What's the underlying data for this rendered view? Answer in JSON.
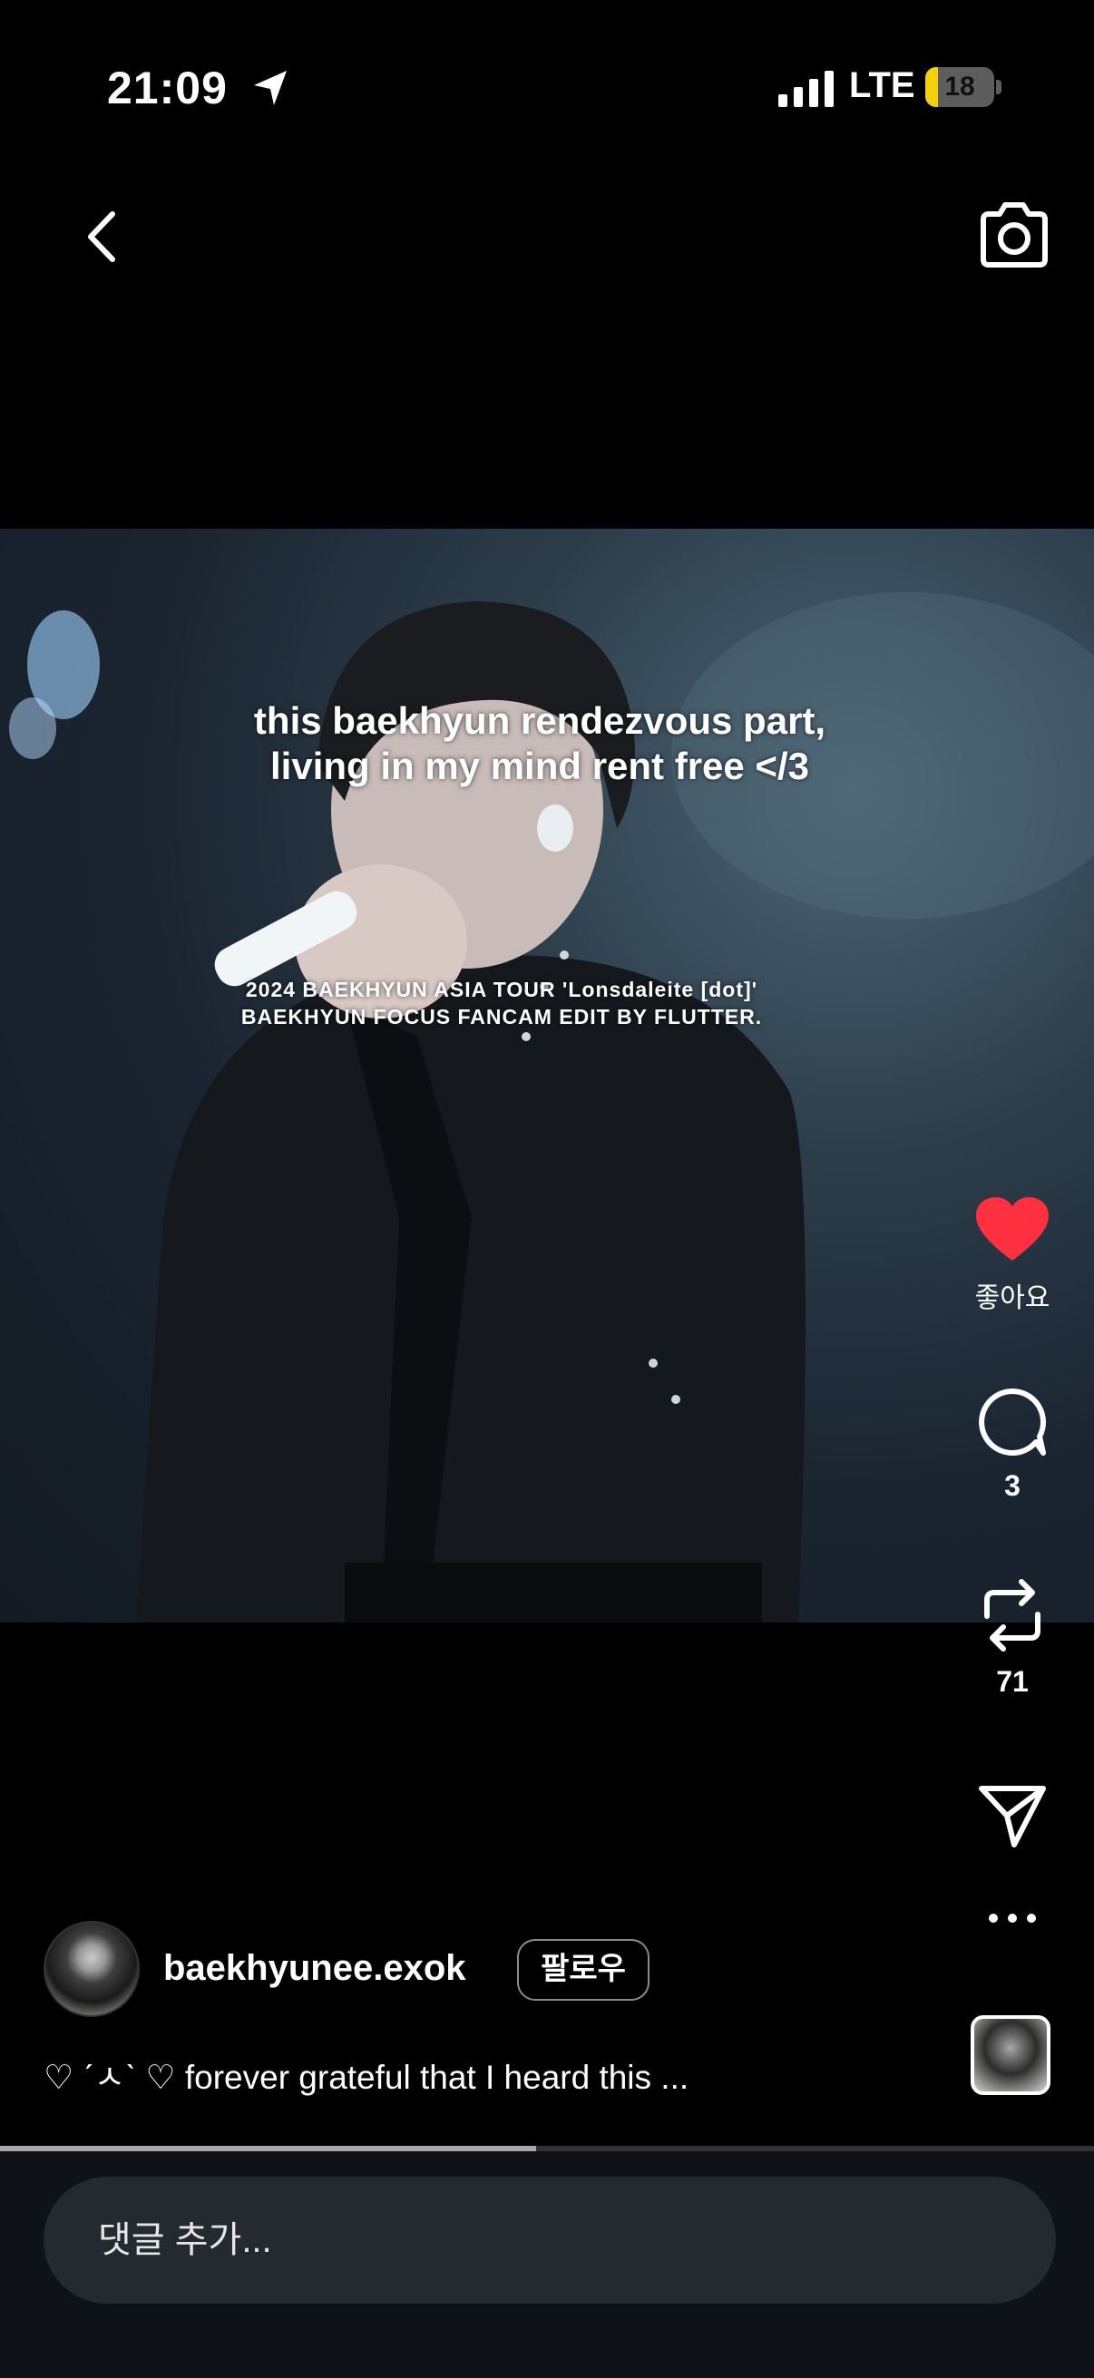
{
  "status_bar": {
    "time": "21:09",
    "network": "LTE",
    "battery_level": "18",
    "battery_fraction": 0.18,
    "battery_color": "#f5d10a"
  },
  "nav": {
    "back_icon": "chevron-left-icon",
    "camera_icon": "camera-icon"
  },
  "video": {
    "caption_line1": "this baekhyun rendezvous part,",
    "caption_line2": "living in my mind rent free </3",
    "credit_line1": "2024 BAEKHYUN ASIA TOUR 'Lonsdaleite [dot]'",
    "credit_line2": "BAEKHYUN FOCUS FANCAM EDIT BY FLUTTER."
  },
  "actions": {
    "like_label": "좋아요",
    "like_color": "#ff3040",
    "comment_count": "3",
    "repost_count": "71"
  },
  "post": {
    "username": "baekhyunee.exok",
    "follow_label": "팔로우",
    "caption": "♡ ˊㅅˋ ♡ forever grateful that I heard this ..."
  },
  "progress": {
    "fraction": 0.49
  },
  "comment": {
    "placeholder": "댓글 추가..."
  }
}
